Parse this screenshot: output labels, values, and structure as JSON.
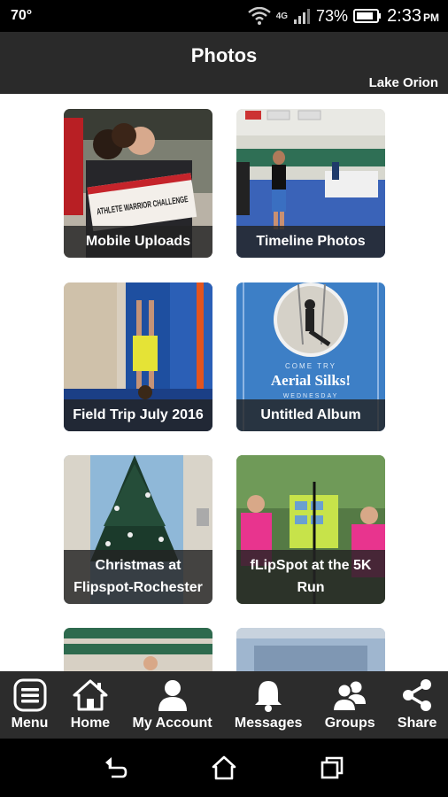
{
  "status": {
    "temperature": "70°",
    "network": "4G",
    "battery": "73%",
    "time": "2:33",
    "ampm": "PM"
  },
  "header": {
    "title": "Photos",
    "location": "Lake Orion"
  },
  "albums": [
    {
      "label": "Mobile Uploads",
      "sign_text": "ATHLETE WARRIOR CHALLENGE"
    },
    {
      "label": "Timeline Photos"
    },
    {
      "label": "Field Trip July 2016"
    },
    {
      "label": "Untitled Album",
      "poster_line1": "COME TRY",
      "poster_line2": "Aerial Silks!",
      "poster_line3": "WEDNESDAY"
    },
    {
      "label": "Christmas at Flipspot-Rochester"
    },
    {
      "label": "fLipSpot at the 5K Run"
    }
  ],
  "nav": [
    {
      "label": "Menu",
      "icon": "menu-icon"
    },
    {
      "label": "Home",
      "icon": "home-icon"
    },
    {
      "label": "My Account",
      "icon": "account-icon"
    },
    {
      "label": "Messages",
      "icon": "bell-icon"
    },
    {
      "label": "Groups",
      "icon": "groups-icon"
    },
    {
      "label": "Share",
      "icon": "share-icon"
    }
  ],
  "colors": {
    "header_bg": "#2a2a2a",
    "nav_bg": "#2c2c2c",
    "label_bg": "#232323",
    "poster_blue": "#3d7fc6"
  }
}
